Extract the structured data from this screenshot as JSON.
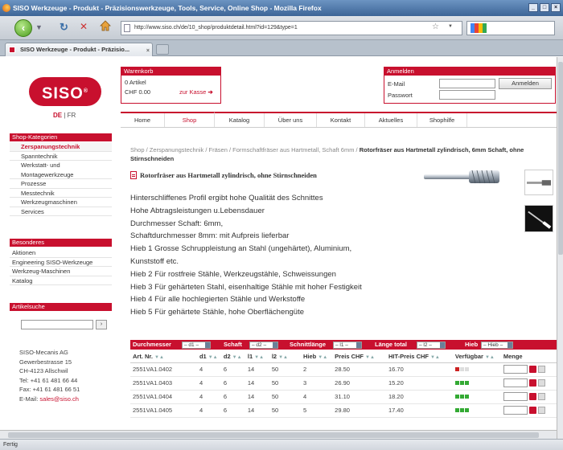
{
  "browser": {
    "title": "SISO Werkzeuge - Produkt - Präzisionswerkzeuge, Tools, Service, Online Shop - Mozilla Firefox",
    "url": "http://www.siso.ch/de/10_shop/produktdetail.html?id=129&type=1",
    "tab_label": "SISO Werkzeuge - Produkt - Präzisio...",
    "status": "Fertig"
  },
  "brand": {
    "logo_text": "SISO",
    "logo_reg": "®",
    "lang_de": "DE",
    "lang_sep": "|",
    "lang_fr": "FR",
    "accent_color": "#c8102e"
  },
  "cart": {
    "heading": "Warenkorb",
    "items": "0 Artikel",
    "total": "CHF 0.00",
    "checkout_label": "zur Kasse",
    "checkout_arrow": "➔"
  },
  "login": {
    "heading": "Anmelden",
    "email_label": "E-Mail",
    "password_label": "Passwort",
    "button_label": "Anmelden"
  },
  "nav": {
    "items": [
      "Home",
      "Shop",
      "Katalog",
      "Über uns",
      "Kontakt",
      "Aktuelles",
      "Shophilfe"
    ],
    "active": "Shop"
  },
  "sidebar": {
    "categories_heading": "Shop-Kategorien",
    "categories": [
      "Zerspanungstechnik",
      "Spanntechnik",
      "Werkstatt- und",
      "Montagewerkzeuge",
      "Prozesse",
      "Messtechnik",
      "Werkzeugmaschinen",
      "Services"
    ],
    "specials_heading": "Besonderes",
    "specials": [
      "Aktionen",
      "Engineering SISO-Werkzeuge",
      "Werkzeug-Maschinen",
      "Katalog"
    ],
    "search_heading": "Artikelsuche",
    "search_button": "›",
    "address": {
      "company": "SISO-Mecanis AG",
      "street": "Gewerbestrasse 15",
      "city": "CH-4123 Allschwil",
      "tel": "Tel: +41 61 481 66 44",
      "fax": "Fax: +41 61 481 66 51",
      "email_label": "E-Mail: ",
      "email": "sales@siso.ch"
    }
  },
  "breadcrumb": {
    "path": "Shop / Zerspanungstechnik / Fräsen / Formschaftfräser aus Hartmetall, Schaft 6mm / ",
    "current": "Rotorfräser aus Hartmetall zylindrisch, 6mm Schaft, ohne Stirnschneiden"
  },
  "product": {
    "title": "Rotorfräser aus Hartmetall zylindrisch, ohne Stirnschneiden",
    "description": [
      "Hinterschliffenes Profil ergibt hohe Qualität des Schnittes",
      "Hohe Abtragsleistungen u.Lebensdauer",
      "Durchmesser Schaft: 6mm,",
      "Schaftdurchmesser 8mm: mit Aufpreis lieferbar",
      "Hieb 1  Grosse Schruppleistung an Stahl (ungehärtet), Aluminium,",
      "Kunststoff etc.",
      "Hieb 2  Für rostfreie Stähle, Werkzeugstähle, Schweissungen",
      "Hieb 3  Für gehärteten Stahl, eisenhaltige Stähle mit hoher Festigkeit",
      "Hieb 4  Für alle hochlegierten Stähle und Werkstoffe",
      "Hieb 5  Für gehärtete Stähle, hohe Oberflächengüte"
    ]
  },
  "filters": [
    {
      "label": "Durchmesser",
      "select": "– d1 –"
    },
    {
      "label": "Schaft",
      "select": "– d2 –"
    },
    {
      "label": "Schnittlänge",
      "select": "– l1 –"
    },
    {
      "label": "Länge total",
      "select": "– l2 –"
    },
    {
      "label": "Hieb",
      "select": "– Hieb –"
    }
  ],
  "table": {
    "sort_icon": "▼▲",
    "columns": [
      "Art. Nr.",
      "d1",
      "d2",
      "l1",
      "l2",
      "Hieb",
      "Preis CHF",
      "HIT-Preis CHF",
      "Verfügbar",
      "Menge"
    ],
    "sortable": [
      true,
      true,
      true,
      true,
      true,
      true,
      true,
      true,
      true,
      false
    ],
    "rows": [
      {
        "art": "2551VA1.0402",
        "d1": "4",
        "d2": "6",
        "l1": "14",
        "l2": "50",
        "hieb": "2",
        "price": "28.50",
        "hit": "16.70",
        "avail": [
          "#cc2222",
          "#dddddd",
          "#dddddd"
        ]
      },
      {
        "art": "2551VA1.0403",
        "d1": "4",
        "d2": "6",
        "l1": "14",
        "l2": "50",
        "hieb": "3",
        "price": "26.90",
        "hit": "15.20",
        "avail": [
          "#33aa33",
          "#33aa33",
          "#33aa33"
        ]
      },
      {
        "art": "2551VA1.0404",
        "d1": "4",
        "d2": "6",
        "l1": "14",
        "l2": "50",
        "hieb": "4",
        "price": "31.10",
        "hit": "18.20",
        "avail": [
          "#33aa33",
          "#33aa33",
          "#33aa33"
        ]
      },
      {
        "art": "2551VA1.0405",
        "d1": "4",
        "d2": "6",
        "l1": "14",
        "l2": "50",
        "hieb": "5",
        "price": "29.80",
        "hit": "17.40",
        "avail": [
          "#33aa33",
          "#33aa33",
          "#33aa33"
        ]
      }
    ]
  }
}
